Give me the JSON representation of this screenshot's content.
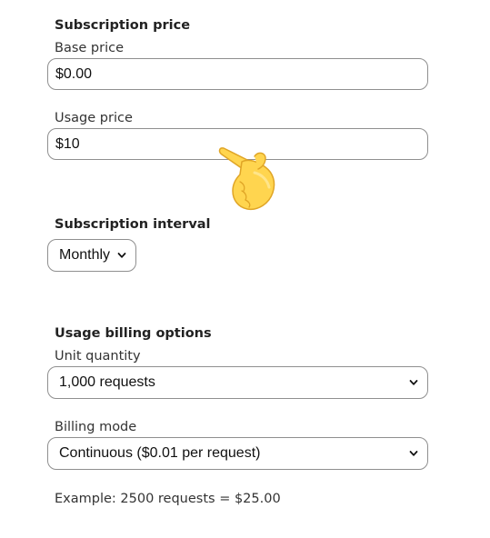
{
  "subscription_price": {
    "heading": "Subscription price",
    "base_price": {
      "label": "Base price",
      "value": "$0.00"
    },
    "usage_price": {
      "label": "Usage price",
      "value": "$10"
    }
  },
  "subscription_interval": {
    "heading": "Subscription interval",
    "selected": "Monthly"
  },
  "usage_billing": {
    "heading": "Usage billing options",
    "unit_quantity": {
      "label": "Unit quantity",
      "selected": "1,000 requests"
    },
    "billing_mode": {
      "label": "Billing mode",
      "selected": "Continuous ($0.01 per request)"
    }
  },
  "example_text": "Example: 2500 requests = $25.00",
  "icons": {
    "pointer": "pointing-hand-emoji",
    "dropdown": "chevron-down-icon"
  },
  "colors": {
    "text": "#222222",
    "border": "#8f8f8f",
    "hand_fill": "#FFD54F",
    "hand_outline": "#E0A526"
  }
}
